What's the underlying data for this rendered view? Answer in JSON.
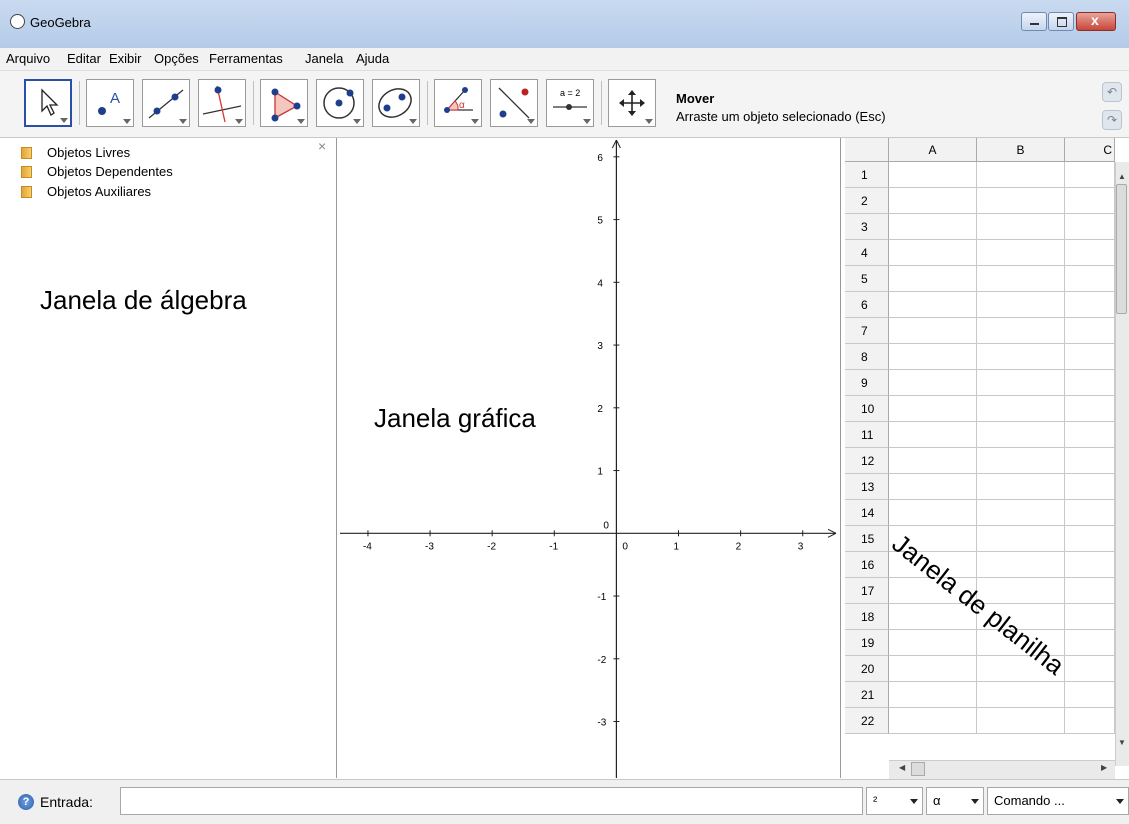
{
  "window": {
    "title": "GeoGebra"
  },
  "menu": [
    "Arquivo",
    "Editar",
    "Exibir",
    "Opções",
    "Ferramentas",
    "Janela",
    "Ajuda"
  ],
  "toolbar": {
    "tools": [
      "move-tool",
      "point-tool",
      "line-tool",
      "perpendicular-line-tool",
      "polygon-tool",
      "circle-tool",
      "conic-tool",
      "angle-tool",
      "reflect-tool",
      "slider-tool",
      "move-graphics-view-tool"
    ],
    "slider_icon_text": "a = 2",
    "tool_name": "Mover",
    "tool_help": "Arraste um objeto selecionado (Esc)"
  },
  "algebra": {
    "folders": [
      "Objetos Livres",
      "Objetos Dependentes",
      "Objetos Auxiliares"
    ],
    "close_glyph": "×",
    "label": "Janela de álgebra"
  },
  "graphics": {
    "label": "Janela gráfica",
    "x_ticks": [
      -4,
      -3,
      -2,
      -1,
      0,
      1,
      2,
      3
    ],
    "y_ticks": [
      6,
      5,
      4,
      3,
      2,
      1,
      -1,
      -2,
      -3
    ],
    "x_range": [
      -4.45,
      3.6
    ],
    "y_range": [
      -3.9,
      6.3
    ],
    "origin_label": "0"
  },
  "spreadsheet": {
    "columns": [
      "A",
      "B",
      "C"
    ],
    "rows": [
      "1",
      "2",
      "3",
      "4",
      "5",
      "6",
      "7",
      "8",
      "9",
      "10",
      "11",
      "12",
      "13",
      "14",
      "15",
      "16",
      "17",
      "18",
      "19",
      "20",
      "21",
      "22"
    ],
    "label": "Janela de planilha"
  },
  "input_bar": {
    "label": "Entrada:",
    "value": "",
    "dropdown_1": "²",
    "dropdown_2": "α",
    "dropdown_3": "Comando ..."
  },
  "colors": {
    "titlebar": "#bcd0ea",
    "accent": "#2b4fa8",
    "close": "#c8473a"
  }
}
